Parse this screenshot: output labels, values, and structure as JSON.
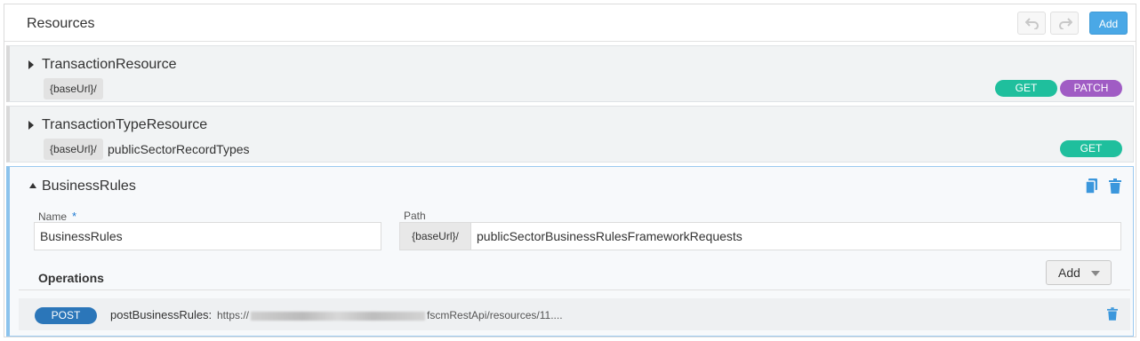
{
  "header": {
    "title": "Resources",
    "add_label": "Add"
  },
  "resources": [
    {
      "name": "TransactionResource",
      "base": "{baseUrl}/",
      "path": "",
      "methods": [
        "GET",
        "PATCH"
      ]
    },
    {
      "name": "TransactionTypeResource",
      "base": "{baseUrl}/",
      "path": "publicSectorRecordTypes",
      "methods": [
        "GET"
      ]
    }
  ],
  "expanded": {
    "name": "BusinessRules",
    "name_label": "Name",
    "required_marker": "*",
    "name_value": "BusinessRules",
    "path_label": "Path",
    "path_base": "{baseUrl}/",
    "path_value": "publicSectorBusinessRulesFrameworkRequests",
    "operations_title": "Operations",
    "operations_add_label": "Add",
    "operations": [
      {
        "method": "POST",
        "name": "postBusinessRules:",
        "url_prefix": "https://",
        "url_suffix": "fscmRestApi/resources/11...."
      }
    ]
  },
  "colors": {
    "get": "#1fbf9d",
    "patch": "#a05cc4",
    "post": "#2b76b9",
    "accent": "#4aa8e6"
  },
  "icons": [
    "undo-icon",
    "redo-icon",
    "caret-right-icon",
    "caret-down-icon",
    "copy-icon",
    "trash-icon",
    "dropdown-arrow-icon"
  ]
}
